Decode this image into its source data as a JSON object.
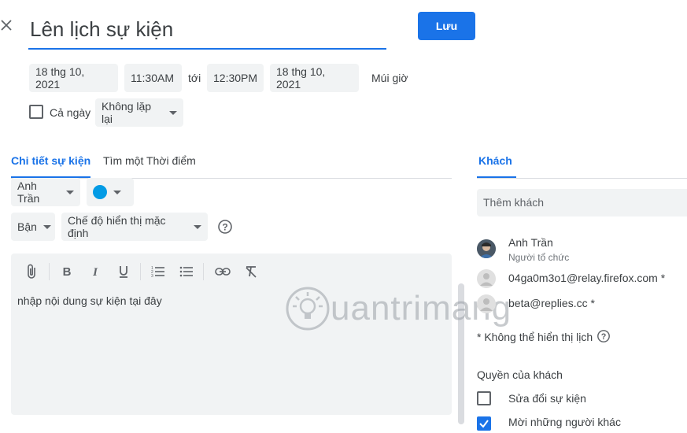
{
  "header": {
    "title": "Lên lịch sự kiện",
    "save_label": "Lưu"
  },
  "datetime": {
    "start_date": "18 thg 10, 2021",
    "start_time": "11:30AM",
    "to_label": "tới",
    "end_time": "12:30PM",
    "end_date": "18 thg 10, 2021",
    "timezone_label": "Múi giờ"
  },
  "options": {
    "all_day_label": "Cả ngày",
    "all_day_checked": false,
    "repeat_value": "Không lặp lại"
  },
  "tabs": [
    {
      "label": "Chi tiết sự kiện",
      "active": true
    },
    {
      "label": "Tìm một Thời điểm",
      "active": false
    }
  ],
  "details": {
    "calendar_owner": "Anh Trần",
    "event_color": "#039be5",
    "busy_value": "Bận",
    "visibility_value": "Chế độ hiển thị mặc định",
    "description": "nhập nội dung sự kiện tại đây"
  },
  "toolbar_icons": [
    "attachment-icon",
    "bold-icon",
    "italic-icon",
    "underline-icon",
    "numbered-list-icon",
    "bulleted-list-icon",
    "link-icon",
    "clear-format-icon"
  ],
  "guests": {
    "tab_label": "Khách",
    "add_placeholder": "Thêm khách",
    "list": [
      {
        "name": "Anh Trần",
        "role": "Người tổ chức"
      },
      {
        "name": "04ga0m3o1@relay.firefox.com *",
        "role": ""
      },
      {
        "name": "beta@replies.cc *",
        "role": ""
      }
    ],
    "calendar_note": "* Không thể hiển thị lịch",
    "permissions_title": "Quyền của khách",
    "permissions": [
      {
        "label": "Sửa đổi sự kiện",
        "checked": false
      },
      {
        "label": "Mời những người khác",
        "checked": true
      }
    ]
  },
  "watermark": "uantrimang",
  "colors": {
    "accent": "#1a73e8",
    "chip_bg": "#f1f3f4"
  }
}
